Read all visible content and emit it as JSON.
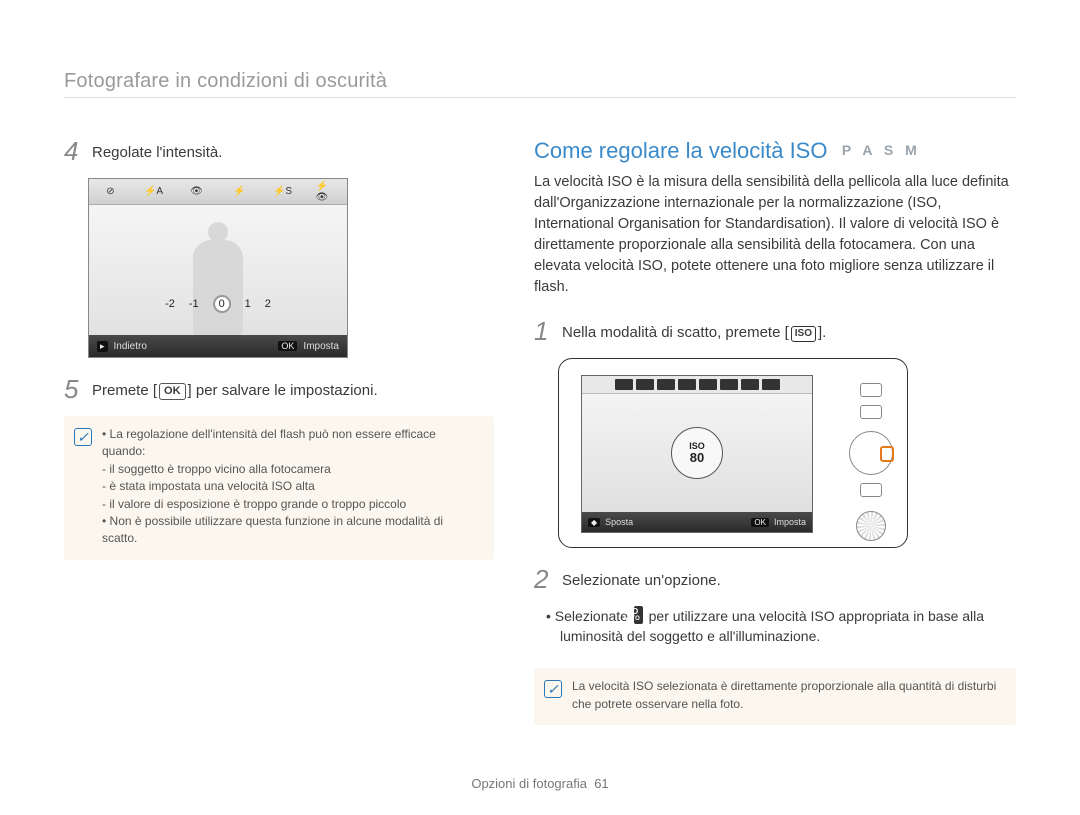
{
  "breadcrumb": "Fotografare in condizioni di oscurità",
  "left": {
    "step4_num": "4",
    "step4_text": "Regolate l'intensità.",
    "step5_num": "5",
    "step5_pre": "Premete [",
    "step5_ok": "OK",
    "step5_post": "] per salvare le impostazioni.",
    "camscreen": {
      "scale": {
        "m2": "-2",
        "m1": "-1",
        "zero": "0",
        "p1": "1",
        "p2": "2"
      },
      "back_key": "▸",
      "back_label": "Indietro",
      "ok_key": "OK",
      "ok_label": "Imposta"
    },
    "note": {
      "l1": "La regolazione dell'intensità del flash può non essere efficace quando:",
      "d1": "il soggetto è troppo vicino alla fotocamera",
      "d2": "è stata impostata una velocità ISO alta",
      "d3": "il valore di esposizione è troppo grande o troppo piccolo",
      "l2": "Non è possibile utilizzare questa funzione in alcune modalità di scatto."
    }
  },
  "right": {
    "heading": "Come regolare la velocità ISO",
    "modes": "P A S M",
    "para": "La velocità ISO è la misura della sensibilità della pellicola alla luce definita dall'Organizzazione internazionale per la normalizzazione (ISO, International Organisation for Standardisation). Il valore di velocità ISO è direttamente proporzionale alla sensibilità della fotocamera. Con una elevata velocità ISO, potete ottenere una foto migliore senza utilizzare il flash.",
    "step1_num": "1",
    "step1_pre": "Nella modalità di scatto, premete [",
    "step1_iso": "ISO",
    "step1_post": "].",
    "cam2": {
      "dial_top": "ISO",
      "dial_val": "80",
      "move_key": "◆",
      "move_label": "Sposta",
      "ok_key": "OK",
      "ok_label": "Imposta"
    },
    "step2_num": "2",
    "step2_text": "Selezionate un'opzione.",
    "sub_pre": "Selezionate ",
    "sub_badge_top": "ISO",
    "sub_badge_bot": "AUTO",
    "sub_post": " per utilizzare una velocità ISO appropriata in base alla luminosità del soggetto e all'illuminazione.",
    "note2": "La velocità ISO selezionata è direttamente proporzionale alla quantità di disturbi che potrete osservare nella foto."
  },
  "footer": {
    "section": "Opzioni di fotografia",
    "page": "61"
  }
}
